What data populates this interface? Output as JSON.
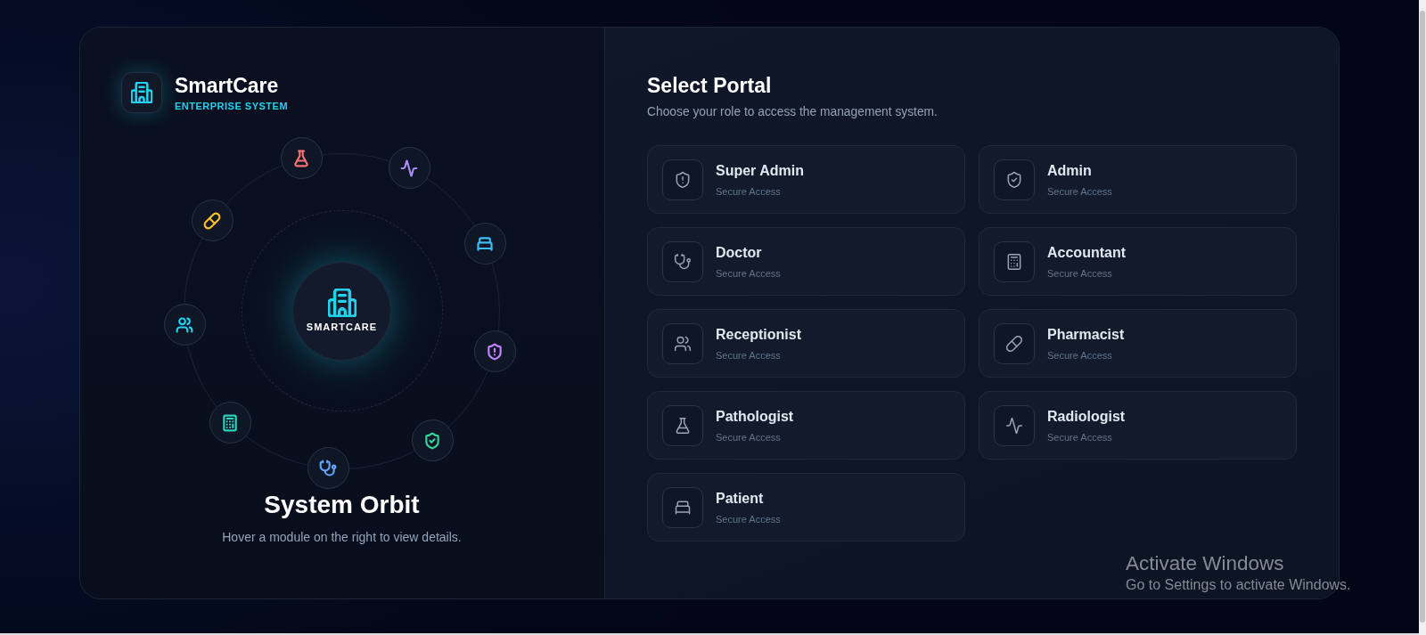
{
  "brand": {
    "name": "SmartCare",
    "tagline": "ENTERPRISE SYSTEM"
  },
  "orbit": {
    "hub_label": "SMARTCARE",
    "nodes": [
      {
        "color": "#c084fc"
      },
      {
        "color": "#34d399"
      },
      {
        "color": "#60a5fa"
      },
      {
        "color": "#2dd4bf"
      },
      {
        "color": "#22d3ee"
      },
      {
        "color": "#fbbf24"
      },
      {
        "color": "#f87171"
      },
      {
        "color": "#a78bfa"
      },
      {
        "color": "#38bdf8"
      }
    ],
    "title": "System Orbit",
    "hint": "Hover a module on the right to view details."
  },
  "portal": {
    "title": "Select Portal",
    "subtitle": "Choose your role to access the management system.",
    "options": [
      {
        "title": "Super Admin",
        "subtitle": "Secure Access"
      },
      {
        "title": "Admin",
        "subtitle": "Secure Access"
      },
      {
        "title": "Doctor",
        "subtitle": "Secure Access"
      },
      {
        "title": "Accountant",
        "subtitle": "Secure Access"
      },
      {
        "title": "Receptionist",
        "subtitle": "Secure Access"
      },
      {
        "title": "Pharmacist",
        "subtitle": "Secure Access"
      },
      {
        "title": "Pathologist",
        "subtitle": "Secure Access"
      },
      {
        "title": "Radiologist",
        "subtitle": "Secure Access"
      },
      {
        "title": "Patient",
        "subtitle": "Secure Access"
      }
    ]
  },
  "os_watermark": {
    "title": "Activate Windows",
    "message": "Go to Settings to activate Windows."
  }
}
